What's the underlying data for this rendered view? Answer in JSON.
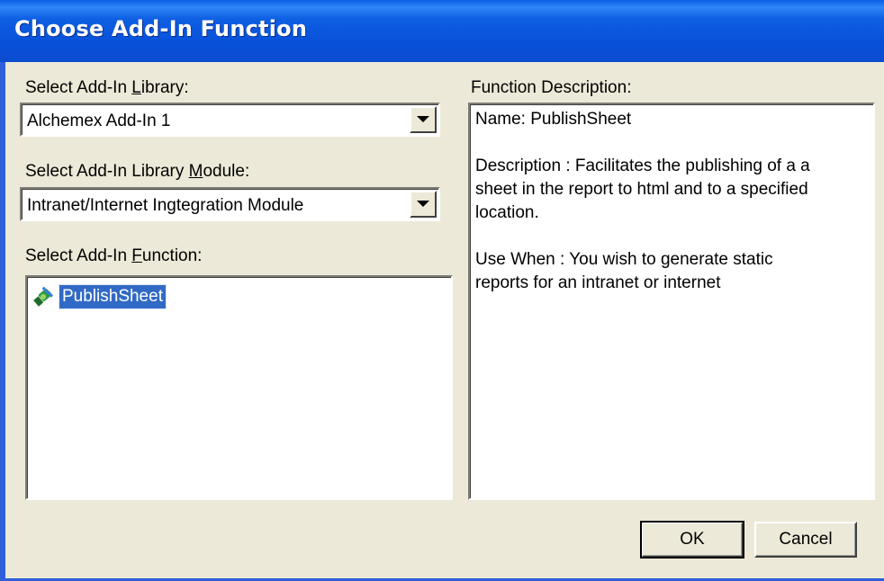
{
  "window": {
    "title": "Choose Add-In Function"
  },
  "library": {
    "label_pre": "Select Add-In ",
    "label_accel": "L",
    "label_post": "ibrary:",
    "value": "Alchemex Add-In 1"
  },
  "module": {
    "label_pre": "Select Add-In Library ",
    "label_accel": "M",
    "label_post": "odule:",
    "value": "Intranet/Internet Ingtegration Module"
  },
  "function": {
    "label_pre": "Select Add-In ",
    "label_accel": "F",
    "label_post": "unction:",
    "items": [
      {
        "label": "PublishSheet",
        "icon": "plug-icon",
        "selected": true
      }
    ]
  },
  "description": {
    "label": "Function Description:",
    "lines": [
      "Name: PublishSheet",
      "",
      "Description : Facilitates the publishing of a a",
      "sheet in the report to html and to a specified",
      "location.",
      "",
      "Use When : You wish to generate static",
      "reports for an intranet or internet"
    ]
  },
  "buttons": {
    "ok": "OK",
    "cancel": "Cancel"
  },
  "colors": {
    "titlebar": "#0751d9",
    "dialog_bg": "#ece9d8",
    "selection": "#316ac5"
  }
}
